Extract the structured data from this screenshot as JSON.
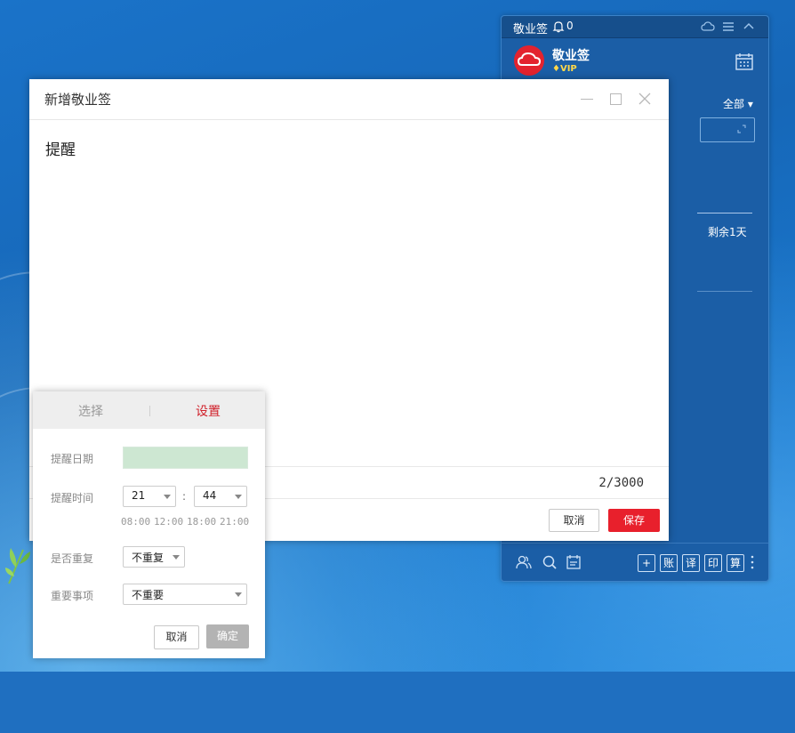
{
  "widget": {
    "title": "敬业签",
    "bell_count": "0",
    "user_name": "敬业签",
    "vip_label": "VIP",
    "filter_label": "全部 ▾",
    "remaining": "剩余1天",
    "tool_labels": [
      "+",
      "账",
      "译",
      "印",
      "算"
    ]
  },
  "editor": {
    "title": "新增敬业签",
    "content": "提醒",
    "counter": "2/3000",
    "cancel_label": "取消",
    "save_label": "保存"
  },
  "reminder": {
    "tabs": [
      "选择",
      "设置"
    ],
    "active_tab": "设置",
    "date_label": "提醒日期",
    "date_value": "",
    "time_label": "提醒时间",
    "hour": "21",
    "minute": "44",
    "colon": ":",
    "quick_times": [
      "08:00",
      "12:00",
      "18:00",
      "21:00"
    ],
    "repeat_label": "是否重复",
    "repeat_value": "不重复",
    "importance_label": "重要事项",
    "importance_value": "不重要",
    "cancel_label": "取消",
    "ok_label": "确定"
  },
  "colors": {
    "accent_red": "#e8202c",
    "widget_blue": "#1b5ea6",
    "date_green": "#cde7d2"
  },
  "icons": [
    "bell-icon",
    "cloud-icon",
    "menu-icon",
    "collapse-icon",
    "calendar-icon",
    "contacts-icon",
    "search-icon",
    "notes-icon",
    "minimize-icon",
    "maximize-icon",
    "close-icon",
    "more-icon"
  ]
}
